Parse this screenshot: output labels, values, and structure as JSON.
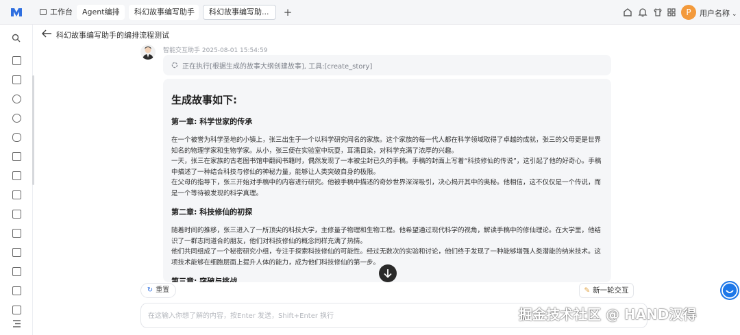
{
  "topbar": {
    "tabs": [
      {
        "label": "工作台"
      },
      {
        "label": "Agent编排"
      },
      {
        "label": "科幻故事编写助手"
      },
      {
        "label": "科幻故事编写助..."
      }
    ],
    "add_label": "+",
    "user": {
      "avatar_letter": "P",
      "name": "用户名称"
    }
  },
  "header": {
    "back_icon": "arrow-left-icon",
    "title": "科幻故事编写助手的编排流程测试"
  },
  "chat": {
    "sender": "智能交互助手",
    "timestamp": "2025-08-01 15:54:59",
    "exec_status": "正在执行[根据生成的故事大纲创建故事], 工具:[create_story]",
    "story": {
      "title": "生成故事如下:",
      "chapters": [
        {
          "heading": "第一章: 科学世家的传承",
          "paragraphs": [
            "在一个被誉为科学圣地的小镇上，张三出生于一个以科学研究闻名的家族。这个家族的每一代人都在科学领域取得了卓越的成就，张三的父母更是世界知名的物理学家和生物学家。从小，张三便在实验室中玩耍，耳濡目染，对科学充满了浓厚的兴趣。",
            "一天，张三在家族的古老图书馆中翻阅书籍时，偶然发现了一本被尘封已久的手稿。手稿的封面上写着“科技修仙的传说”，这引起了他的好奇心。手稿中描述了一种结合科技与修仙的神秘力量，能够让人类突破自身的极限。",
            "在父母的指导下，张三开始对手稿中的内容进行研究。他被手稿中描述的奇妙世界深深吸引，决心揭开其中的奥秘。他相信，这不仅仅是一个传说，而是一个等待被发现的科学真理。"
          ]
        },
        {
          "heading": "第二章: 科技修仙的初探",
          "paragraphs": [
            "随着时间的推移，张三进入了一所顶尖的科技大学，主修量子物理和生物工程。他希望通过现代科学的视角，解读手稿中的修仙理论。在大学里，他结识了一群志同道合的朋友，他们对科技修仙的概念同样充满了热情。",
            "他们共同组成了一个秘密研究小组，专注于探索科技修仙的可能性。经过无数次的实验和讨论，他们终于发现了一种能够增强人类潜能的纳米技术。这项技术能够在细胞层面上提升人体的能力，成为他们科技修仙的第一步。"
          ]
        },
        {
          "heading": "第三章: 突破与挑战",
          "paragraphs": []
        }
      ]
    },
    "reset_label": "重置",
    "new_label": "新一轮交互",
    "input_placeholder": "在这输入你想了解的内容，按Enter 发送，Shift+Enter 换行",
    "watermark": "掘金技术社区 @ HAND汉得"
  },
  "colors": {
    "accent": "#1d77e8",
    "avatar": "#f39a3c"
  }
}
